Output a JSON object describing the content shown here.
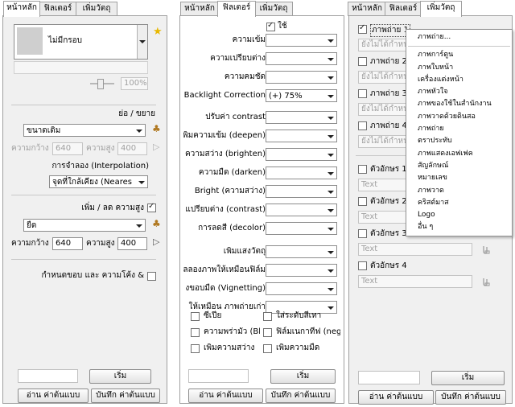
{
  "tabs": [
    "หน้าหลัก",
    "ฟิลเตอร์",
    "เพิ่มวัตถุ"
  ],
  "main": {
    "frame_value": "ไม่มีกรอบ",
    "opacity_value": "100%",
    "resize_title": "ย่อ / ขยาย",
    "size_mode": "ขนาดเดิม",
    "width_label": "ความกว้าง",
    "width_value": "640",
    "height_label": "ความสูง",
    "height_value": "400",
    "interp_label": "การจำลอง (Interpolation)",
    "interp_value": "จุดที่ใกล้เคียง (Neares",
    "canvas_title": "เพิ่ม / ลด ความสูง",
    "canvas_mode": "ยืด",
    "canvas_width_label": "ความกว้าง",
    "canvas_width_value": "640",
    "canvas_height_label": "ความสูง",
    "canvas_height_value": "400",
    "border_label": "กำหนดขอบ และ ความโค้ง  &"
  },
  "filters": {
    "use_label": "ใช้",
    "rows": [
      {
        "label": "ความเข้ม",
        "value": ""
      },
      {
        "label": "ความเปรียบต่าง",
        "value": ""
      },
      {
        "label": "ความคมชัด",
        "value": ""
      },
      {
        "label": "Backlight Correction)",
        "value": "(+) 75%"
      },
      {
        "label": "ปรับค่า contrast",
        "value": ""
      },
      {
        "label": "พิ่มความเข้ม (deepen)",
        "value": ""
      },
      {
        "label": "ความสว่าง (brighten)",
        "value": ""
      },
      {
        "label": "ความมืด (darken)",
        "value": ""
      },
      {
        "label": "Bright (ความสว่าง)",
        "value": ""
      },
      {
        "label": "แปรียบต่าง (contrast)",
        "value": ""
      },
      {
        "label": "การลดสี (decolor)",
        "value": ""
      },
      {
        "label": "เพิ่มแสงวัตถุ",
        "value": ""
      },
      {
        "label": "ลลองภาพให้เหมือนฟิล์ม",
        "value": ""
      },
      {
        "label": "งขอบมืด (Vignetting)",
        "value": ""
      },
      {
        "label": "ให้เหมือน ภาพถ่ายเก่า",
        "value": ""
      }
    ],
    "checks": [
      {
        "label": "ซีเปีย",
        "checked": false
      },
      {
        "label": "ใส่ระดับสีเทา",
        "checked": false
      },
      {
        "label": "ความพร่ามัว (Blu",
        "checked": false
      },
      {
        "label": "ฟิล์มเนกาทีฟ (neg",
        "checked": false
      },
      {
        "label": "เพิ่มความสว่าง",
        "checked": false
      },
      {
        "label": "เพิ่มความมืด",
        "checked": false
      }
    ]
  },
  "objects": {
    "image_rows": [
      {
        "label": "ภาพถ่าย 1",
        "checked": true,
        "field": "ยังไม่ได้กำหน"
      },
      {
        "label": "ภาพถ่าย 2",
        "checked": false,
        "field": "ยังไม่ได้กำหน"
      },
      {
        "label": "ภาพถ่าย 3",
        "checked": false,
        "field": "ยังไม่ได้กำหน"
      },
      {
        "label": "ภาพถ่าย 4",
        "checked": false,
        "field": "ยังไม่ได้กำหน"
      }
    ],
    "text_rows": [
      {
        "label": "ตัวอักษร 1",
        "placeholder": "Text"
      },
      {
        "label": "ตัวอักษร 2",
        "placeholder": "Text"
      },
      {
        "label": "ตัวอักษร 3",
        "placeholder": "Text"
      },
      {
        "label": "ตัวอักษร 4",
        "placeholder": "Text"
      }
    ],
    "menu": [
      "ภาพถ่าย...",
      "ภาพการ์ตูน",
      "ภาพใบหน้า",
      "เครื่องแต่งหน้า",
      "ภาพหัวใจ",
      "ภาพของใช้ในสำนักงาน",
      "ภาพวาดด้วยดินสอ",
      "ภาพถ่าย",
      "ตราประทับ",
      "ภาพแสดงเอฟเฟค",
      "สัญลักษณ์",
      "หมายเลข",
      "ภาพวาด",
      "คริสต์มาส",
      "Logo",
      "อื่น ๆ"
    ]
  },
  "footer": {
    "start": "เริ่ม",
    "load": "อ่าน ค่าต้นแบบ",
    "save": "บันทึก ค่าต้นแบบ"
  }
}
